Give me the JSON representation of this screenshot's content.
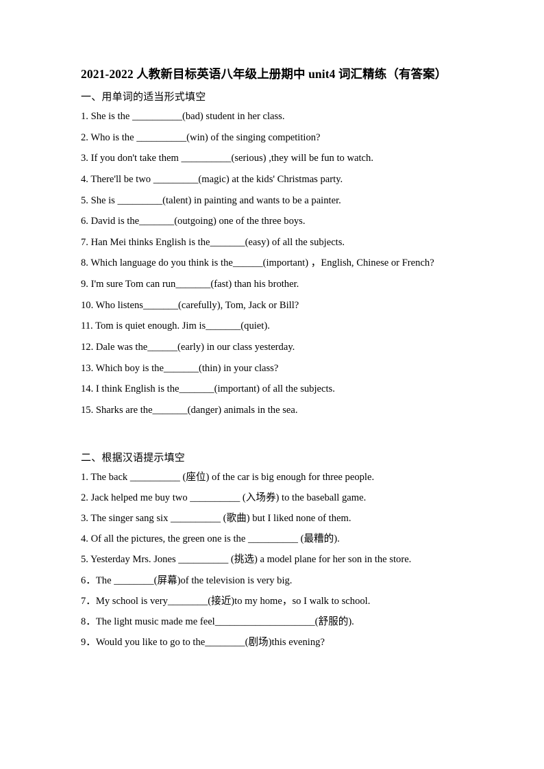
{
  "document": {
    "title": "2021-2022 人教新目标英语八年级上册期中 unit4 词汇精练（有答案）",
    "sections": [
      {
        "heading": "一、用单词的适当形式填空",
        "questions": [
          "1. She is the __________(bad) student in her class.",
          "2. Who is the __________(win) of the singing competition?",
          "3. If you don't take them __________(serious) ,they will be fun to watch.",
          "4. There'll be two _________(magic) at the kids' Christmas party.",
          "5. She is _________(talent) in painting and wants to be a painter.",
          "6. David is the_______(outgoing) one of the three boys.",
          "7. Han Mei thinks English is the_______(easy) of all the subjects.",
          "8. Which language do you think is the______(important) ，English, Chinese or French?",
          "9. I'm sure Tom can run_______(fast) than his brother.",
          "10. Who listens_______(carefully), Tom, Jack or Bill?",
          "11. Tom is quiet enough. Jim is_______(quiet).",
          "12. Dale was the______(early) in our class yesterday.",
          "13. Which boy is the_______(thin) in your class?",
          "14. I think English is the_______(important) of all the subjects.",
          "15. Sharks are the_______(danger) animals in the sea."
        ]
      },
      {
        "heading": "二、根据汉语提示填空",
        "questions": [
          "1. The back __________ (座位) of the car is big enough for three people.",
          "2. Jack helped me buy two __________ (入场券) to the baseball game.",
          "3. The singer sang six __________ (歌曲) but I liked none of them.",
          "4. Of all the pictures, the green one is the __________ (最糟的).",
          "5. Yesterday Mrs. Jones __________ (挑选) a model plane for her son in the store.",
          "6．The ________(屏幕)of the television is very big.",
          "7．My school is very________(接近)to my home，so I walk to school.",
          "8．The light music made me feel____________________(舒服的).",
          "9．Would you like to go to the________(剧场)this evening?"
        ]
      }
    ]
  }
}
